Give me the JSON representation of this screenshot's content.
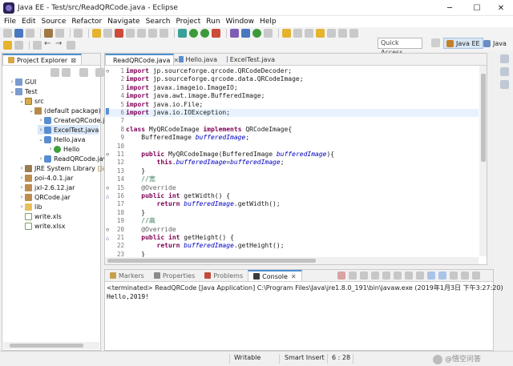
{
  "window": {
    "title": "Java EE - Test/src/ReadQRCode.java - Eclipse",
    "minimize": "─",
    "maximize": "☐",
    "close": "✕"
  },
  "menu": [
    "File",
    "Edit",
    "Source",
    "Refactor",
    "Navigate",
    "Search",
    "Project",
    "Run",
    "Window",
    "Help"
  ],
  "toolbar": {
    "quick_access": "Quick Access",
    "perspectives": [
      "Java EE",
      "Java"
    ]
  },
  "explorer": {
    "tab_label": "Project Explorer",
    "close": "⊠",
    "items": [
      {
        "label": "GUI",
        "icon": "project-icon",
        "twisty": "›"
      },
      {
        "label": "Test",
        "icon": "project-icon",
        "twisty": "⌄"
      },
      {
        "label": "src",
        "icon": "source-folder-icon",
        "twisty": "⌄"
      },
      {
        "label": "(default package)",
        "icon": "package-icon",
        "twisty": "⌄"
      },
      {
        "label": "CreateQRCode.ja",
        "icon": "java-file-icon",
        "twisty": "›"
      },
      {
        "label": "ExcelTest.java",
        "icon": "java-file-icon",
        "twisty": "›"
      },
      {
        "label": "Hello.java",
        "icon": "java-file-icon",
        "twisty": "⌄"
      },
      {
        "label": "Hello",
        "icon": "class-icon",
        "twisty": "›"
      },
      {
        "label": "ReadQRCode.jav",
        "icon": "java-file-icon",
        "twisty": "›"
      },
      {
        "label": "JRE System Library",
        "suffix": "[Jav",
        "icon": "library-icon",
        "twisty": "›"
      },
      {
        "label": "poi-4.0.1.jar",
        "icon": "jar-icon",
        "twisty": "›"
      },
      {
        "label": "jxl-2.6.12.jar",
        "icon": "jar-icon",
        "twisty": "›"
      },
      {
        "label": "QRCode.jar",
        "icon": "jar-icon",
        "twisty": "›"
      },
      {
        "label": "lib",
        "icon": "folder-icon",
        "twisty": "›"
      },
      {
        "label": "write.xls",
        "icon": "file-icon",
        "twisty": ""
      },
      {
        "label": "write.xlsx",
        "icon": "file-icon",
        "twisty": ""
      }
    ]
  },
  "editor": {
    "tabs": [
      {
        "label": "ReadQRCode.java",
        "active": true,
        "close": "✕"
      },
      {
        "label": "Hello.java",
        "active": false
      },
      {
        "label": "ExcelTest.java",
        "active": false
      }
    ],
    "lines": [
      {
        "n": "1",
        "fold": "⊖",
        "tokens": [
          {
            "t": "import",
            "c": "kw"
          },
          {
            "t": " jp.sourceforge.qrcode.QRCodeDecoder;"
          }
        ]
      },
      {
        "n": "2",
        "tokens": [
          {
            "t": "import",
            "c": "kw"
          },
          {
            "t": " jp.sourceforge.qrcode.data.QRCodeImage;"
          }
        ]
      },
      {
        "n": "3",
        "tokens": [
          {
            "t": "import",
            "c": "kw"
          },
          {
            "t": " javax.imageio.ImageIO;"
          }
        ]
      },
      {
        "n": "4",
        "tokens": [
          {
            "t": "import",
            "c": "kw"
          },
          {
            "t": " java.awt.image.BufferedImage;"
          }
        ]
      },
      {
        "n": "5",
        "tokens": [
          {
            "t": "import",
            "c": "kw"
          },
          {
            "t": " java.io.File;"
          }
        ]
      },
      {
        "n": "6",
        "hl": true,
        "tokens": [
          {
            "t": "import",
            "c": "kw"
          },
          {
            "t": " java.io.IOException;"
          }
        ]
      },
      {
        "n": "7",
        "tokens": []
      },
      {
        "n": "8",
        "tokens": [
          {
            "t": "class",
            "c": "kw"
          },
          {
            "t": " MyQRCodeImage "
          },
          {
            "t": "implements",
            "c": "kw"
          },
          {
            "t": " QRCodeImage{"
          }
        ]
      },
      {
        "n": "9",
        "tokens": [
          {
            "t": "    BufferedImage "
          },
          {
            "t": "bufferedImage",
            "c": "fld"
          },
          {
            "t": ";"
          }
        ]
      },
      {
        "n": "10",
        "tokens": []
      },
      {
        "n": "11",
        "fold": "⊖",
        "tokens": [
          {
            "t": "    "
          },
          {
            "t": "public",
            "c": "kw"
          },
          {
            "t": " MyQRCodeImage(BufferedImage "
          },
          {
            "t": "bufferedImage",
            "c": "fld"
          },
          {
            "t": "){"
          }
        ]
      },
      {
        "n": "12",
        "tokens": [
          {
            "t": "        "
          },
          {
            "t": "this",
            "c": "kw"
          },
          {
            "t": "."
          },
          {
            "t": "bufferedImage",
            "c": "fld"
          },
          {
            "t": "="
          },
          {
            "t": "bufferedImage",
            "c": "fld"
          },
          {
            "t": ";"
          }
        ]
      },
      {
        "n": "13",
        "tokens": [
          {
            "t": "    }"
          }
        ]
      },
      {
        "n": "14",
        "tokens": [
          {
            "t": "    "
          },
          {
            "t": "//宽",
            "c": "cmt"
          }
        ]
      },
      {
        "n": "15",
        "fold": "⊖",
        "tokens": [
          {
            "t": "    "
          },
          {
            "t": "@Override",
            "c": "ann"
          }
        ]
      },
      {
        "n": "16",
        "marker": "△",
        "tokens": [
          {
            "t": "    "
          },
          {
            "t": "public",
            "c": "kw"
          },
          {
            "t": " "
          },
          {
            "t": "int",
            "c": "kw"
          },
          {
            "t": " getWidth() {"
          }
        ]
      },
      {
        "n": "17",
        "tokens": [
          {
            "t": "        "
          },
          {
            "t": "return",
            "c": "kw"
          },
          {
            "t": " "
          },
          {
            "t": "bufferedImage",
            "c": "fld"
          },
          {
            "t": ".getWidth();"
          }
        ]
      },
      {
        "n": "18",
        "tokens": [
          {
            "t": "    }"
          }
        ]
      },
      {
        "n": "19",
        "tokens": [
          {
            "t": "    "
          },
          {
            "t": "//高",
            "c": "cmt"
          }
        ]
      },
      {
        "n": "20",
        "fold": "⊖",
        "tokens": [
          {
            "t": "    "
          },
          {
            "t": "@Override",
            "c": "ann"
          }
        ]
      },
      {
        "n": "21",
        "marker": "△",
        "tokens": [
          {
            "t": "    "
          },
          {
            "t": "public",
            "c": "kw"
          },
          {
            "t": " "
          },
          {
            "t": "int",
            "c": "kw"
          },
          {
            "t": " getHeight() {"
          }
        ]
      },
      {
        "n": "22",
        "tokens": [
          {
            "t": "        "
          },
          {
            "t": "return",
            "c": "kw"
          },
          {
            "t": " "
          },
          {
            "t": "bufferedImage",
            "c": "fld"
          },
          {
            "t": ".getHeight();"
          }
        ]
      },
      {
        "n": "23",
        "tokens": [
          {
            "t": "    }"
          }
        ]
      }
    ]
  },
  "bottom": {
    "tabs": [
      {
        "label": "Markers",
        "active": false
      },
      {
        "label": "Properties",
        "active": false
      },
      {
        "label": "Problems",
        "active": false
      },
      {
        "label": "Console",
        "active": true,
        "close": "✕"
      }
    ],
    "console_header": "<terminated> ReadQRCode [Java Application] C:\\Program Files\\Java\\jre1.8.0_191\\bin\\javaw.exe (2019年1月3日 下午3:27:20)",
    "console_output": "Hello,2019!"
  },
  "status": {
    "mode": "Writable",
    "insert": "Smart Insert",
    "position": "6 : 28"
  },
  "watermark": "@悟空问答",
  "colors": {
    "keyword": "#7f0055",
    "field": "#0000c0",
    "comment": "#3f7f5f",
    "annotation": "#646464",
    "active_tab_accent": "#4c8ed0"
  }
}
